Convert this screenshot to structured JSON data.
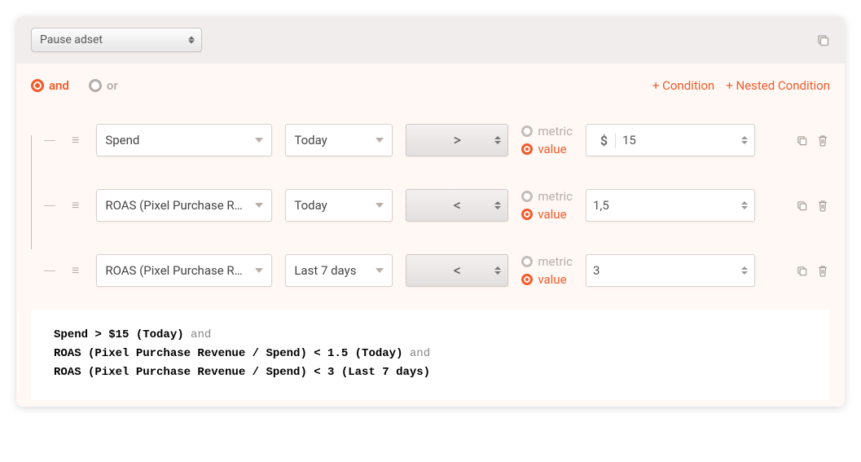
{
  "header": {
    "action_select": "Pause adset"
  },
  "logic": {
    "and_label": "and",
    "or_label": "or",
    "add_condition": "+ Condition",
    "add_nested": "+ Nested Condition"
  },
  "mv_labels": {
    "metric": "metric",
    "value": "value"
  },
  "conditions": [
    {
      "metric": "Spend",
      "range": "Today",
      "operator": ">",
      "value_prefix": "$",
      "value": "15"
    },
    {
      "metric": "ROAS (Pixel Purchase Revenue / Spend)",
      "range": "Today",
      "operator": "<",
      "value_prefix": "",
      "value": "1,5"
    },
    {
      "metric": "ROAS (Pixel Purchase Revenue / Spend)",
      "range": "Last 7 days",
      "operator": "<",
      "value_prefix": "",
      "value": "3"
    }
  ],
  "summary": {
    "l1_a": "Spend > $15 (Today)",
    "l1_b": " and",
    "l2_a": "ROAS (Pixel Purchase Revenue / Spend) < 1.5 (Today)",
    "l2_b": " and",
    "l3_a": "ROAS (Pixel Purchase Revenue / Spend) < 3 (Last 7 days)"
  }
}
